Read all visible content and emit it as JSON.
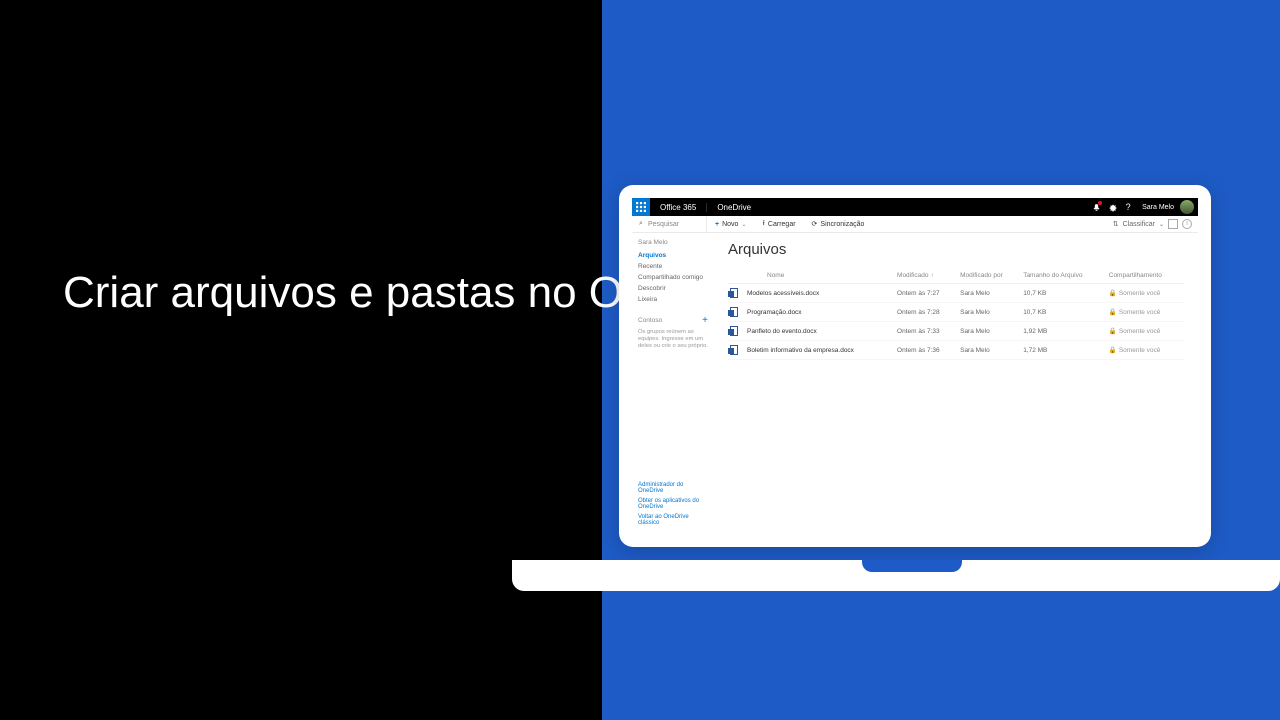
{
  "slide": {
    "title": "Criar arquivos e pastas no OneDrive"
  },
  "topbar": {
    "brand": "Office 365",
    "app": "OneDrive",
    "username": "Sara Melo"
  },
  "search": {
    "placeholder": "Pesquisar"
  },
  "commands": {
    "new": "Novo",
    "upload": "Carregar",
    "sync": "Sincronização",
    "sort": "Classificar"
  },
  "sidebar": {
    "owner": "Sara Melo",
    "items": [
      {
        "label": "Arquivos",
        "active": true
      },
      {
        "label": "Recente",
        "active": false
      },
      {
        "label": "Compartilhado comigo",
        "active": false
      },
      {
        "label": "Descobrir",
        "active": false
      },
      {
        "label": "Lixeira",
        "active": false
      }
    ],
    "groups_header": "Contoso",
    "groups_text": "Os grupos reúnem as equipes. Ingresse em um deles ou crie o seu próprio.",
    "links": [
      "Administrador do OneDrive",
      "Obter os aplicativos do OneDrive",
      "Voltar ao OneDrive clássico"
    ]
  },
  "page": {
    "title": "Arquivos"
  },
  "columns": {
    "name": "Nome",
    "modified": "Modificado",
    "modified_by": "Modificado por",
    "size": "Tamanho do Arquivo",
    "sharing": "Compartilhamento"
  },
  "rows": [
    {
      "name": "Modelos acessíveis.docx",
      "modified": "Ontem às 7:27",
      "by": "Sara Melo",
      "size": "10,7 KB",
      "sharing": "Somente você"
    },
    {
      "name": "Programação.docx",
      "modified": "Ontem às 7:28",
      "by": "Sara Melo",
      "size": "10,7 KB",
      "sharing": "Somente você"
    },
    {
      "name": "Panfleto do evento.docx",
      "modified": "Ontem às 7:33",
      "by": "Sara Melo",
      "size": "1,92 MB",
      "sharing": "Somente você"
    },
    {
      "name": "Boletim informativo da empresa.docx",
      "modified": "Ontem às 7:36",
      "by": "Sara Melo",
      "size": "1,72 MB",
      "sharing": "Somente você"
    }
  ]
}
